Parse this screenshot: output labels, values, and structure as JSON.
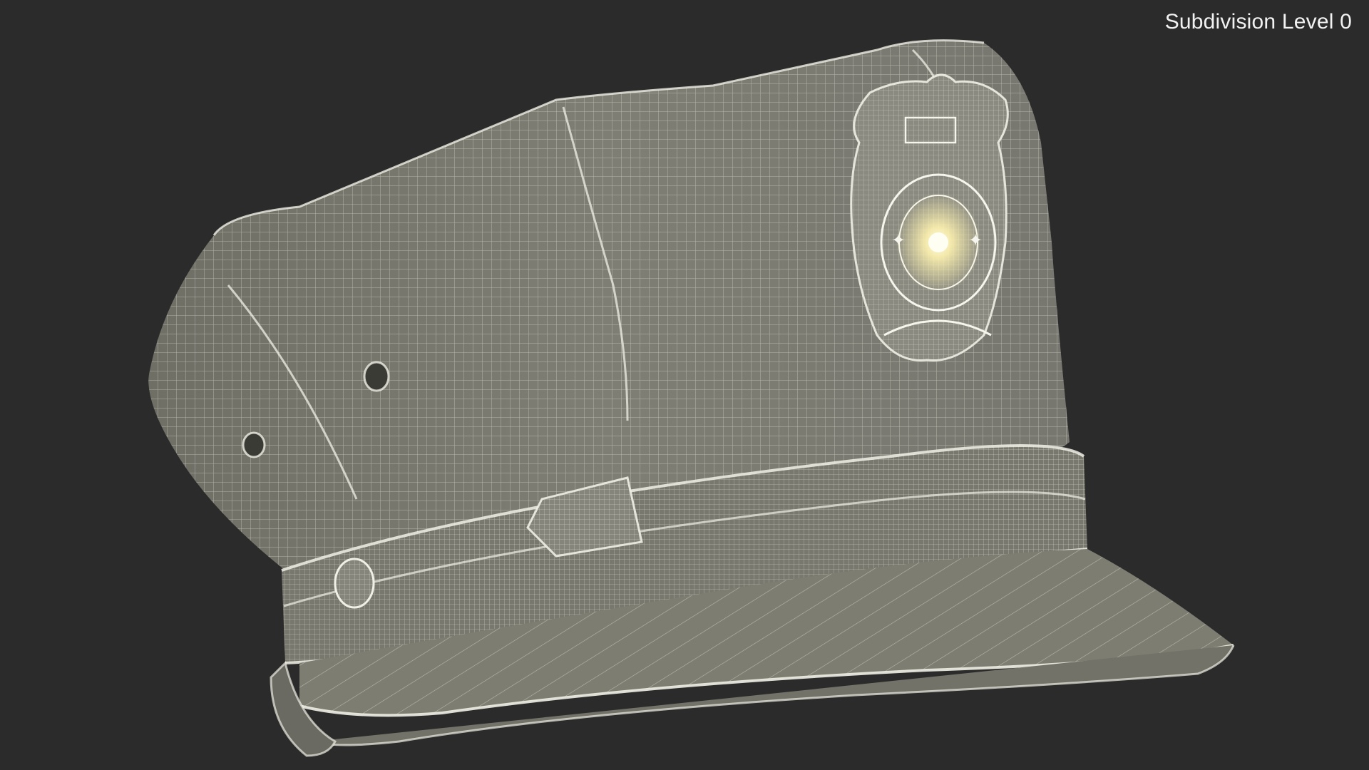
{
  "viewport": {
    "subdivision_label": "Subdivision Level 0"
  },
  "scene": {
    "background_color": "#2b2b2b",
    "mesh_fill_color": "#7b7b71",
    "wire_color": "#e6e6dc",
    "badge_glow_color": "#fff6c8"
  }
}
